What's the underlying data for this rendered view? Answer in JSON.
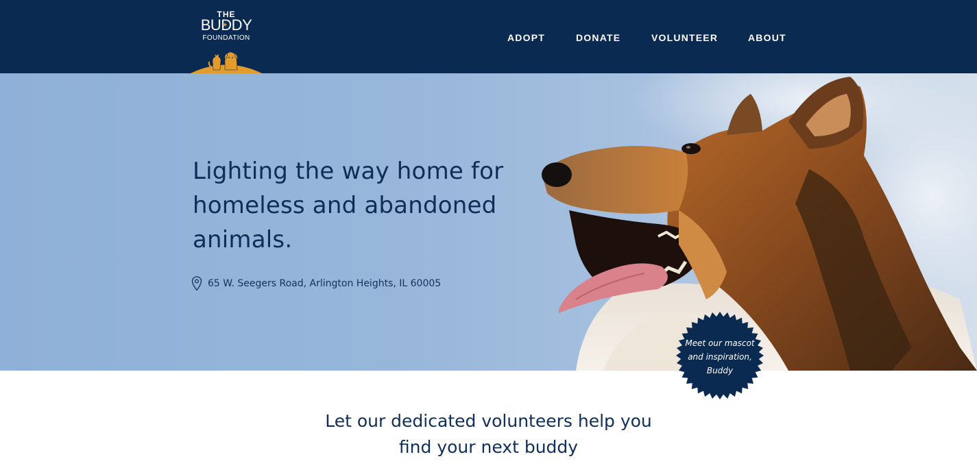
{
  "logo": {
    "line1": "THE",
    "line2": "BUDDY",
    "line3": "FOUNDATION",
    "star_icon": "star-icon",
    "art_icon": "cat-and-dog-silhouette-icon",
    "accent_color": "#e39b2a"
  },
  "nav": {
    "items": [
      {
        "label": "ADOPT"
      },
      {
        "label": "DONATE"
      },
      {
        "label": "VOLUNTEER"
      },
      {
        "label": "ABOUT"
      }
    ]
  },
  "hero": {
    "headline": "Lighting the way home for homeless and abandoned animals.",
    "address_icon": "map-pin-icon",
    "address": "65 W. Seegers Road, Arlington Heights, IL 60005",
    "photo": "collie-dog-photo"
  },
  "badge": {
    "lines": [
      "Meet our mascot",
      "and inspiration,",
      "Buddy"
    ]
  },
  "intro": {
    "lines": [
      "Let our dedicated volunteers help you",
      "find your next buddy"
    ]
  },
  "colors": {
    "header_bg": "#0b2a52",
    "heading_text": "#0f2d56",
    "badge_bg": "#0b2a52",
    "accent": "#e39b2a"
  }
}
